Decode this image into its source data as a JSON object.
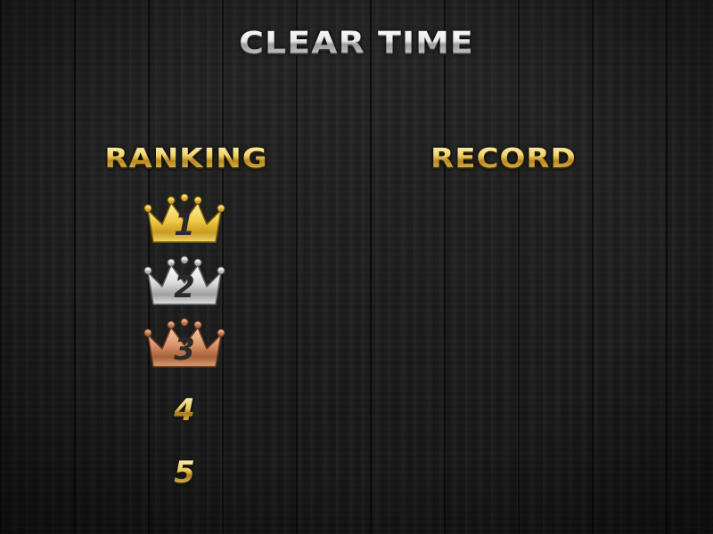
{
  "title": "CLEAR TIME",
  "columns": {
    "ranking_label": "RANKING",
    "record_label": "RECORD"
  },
  "ranks": [
    {
      "number": "1",
      "badge": "crown",
      "color": "#e8c24a"
    },
    {
      "number": "2",
      "badge": "crown",
      "color": "#cfcfcf"
    },
    {
      "number": "3",
      "badge": "crown",
      "color": "#d08b63"
    },
    {
      "number": "4",
      "badge": "none",
      "color": "#e8c65a"
    },
    {
      "number": "5",
      "badge": "none",
      "color": "#e8c65a"
    }
  ],
  "records": [
    "",
    "",
    "",
    "",
    ""
  ],
  "icons": {
    "gold_crown": "gold-crown-icon",
    "silver_crown": "silver-crown-icon",
    "bronze_crown": "bronze-crown-icon"
  }
}
